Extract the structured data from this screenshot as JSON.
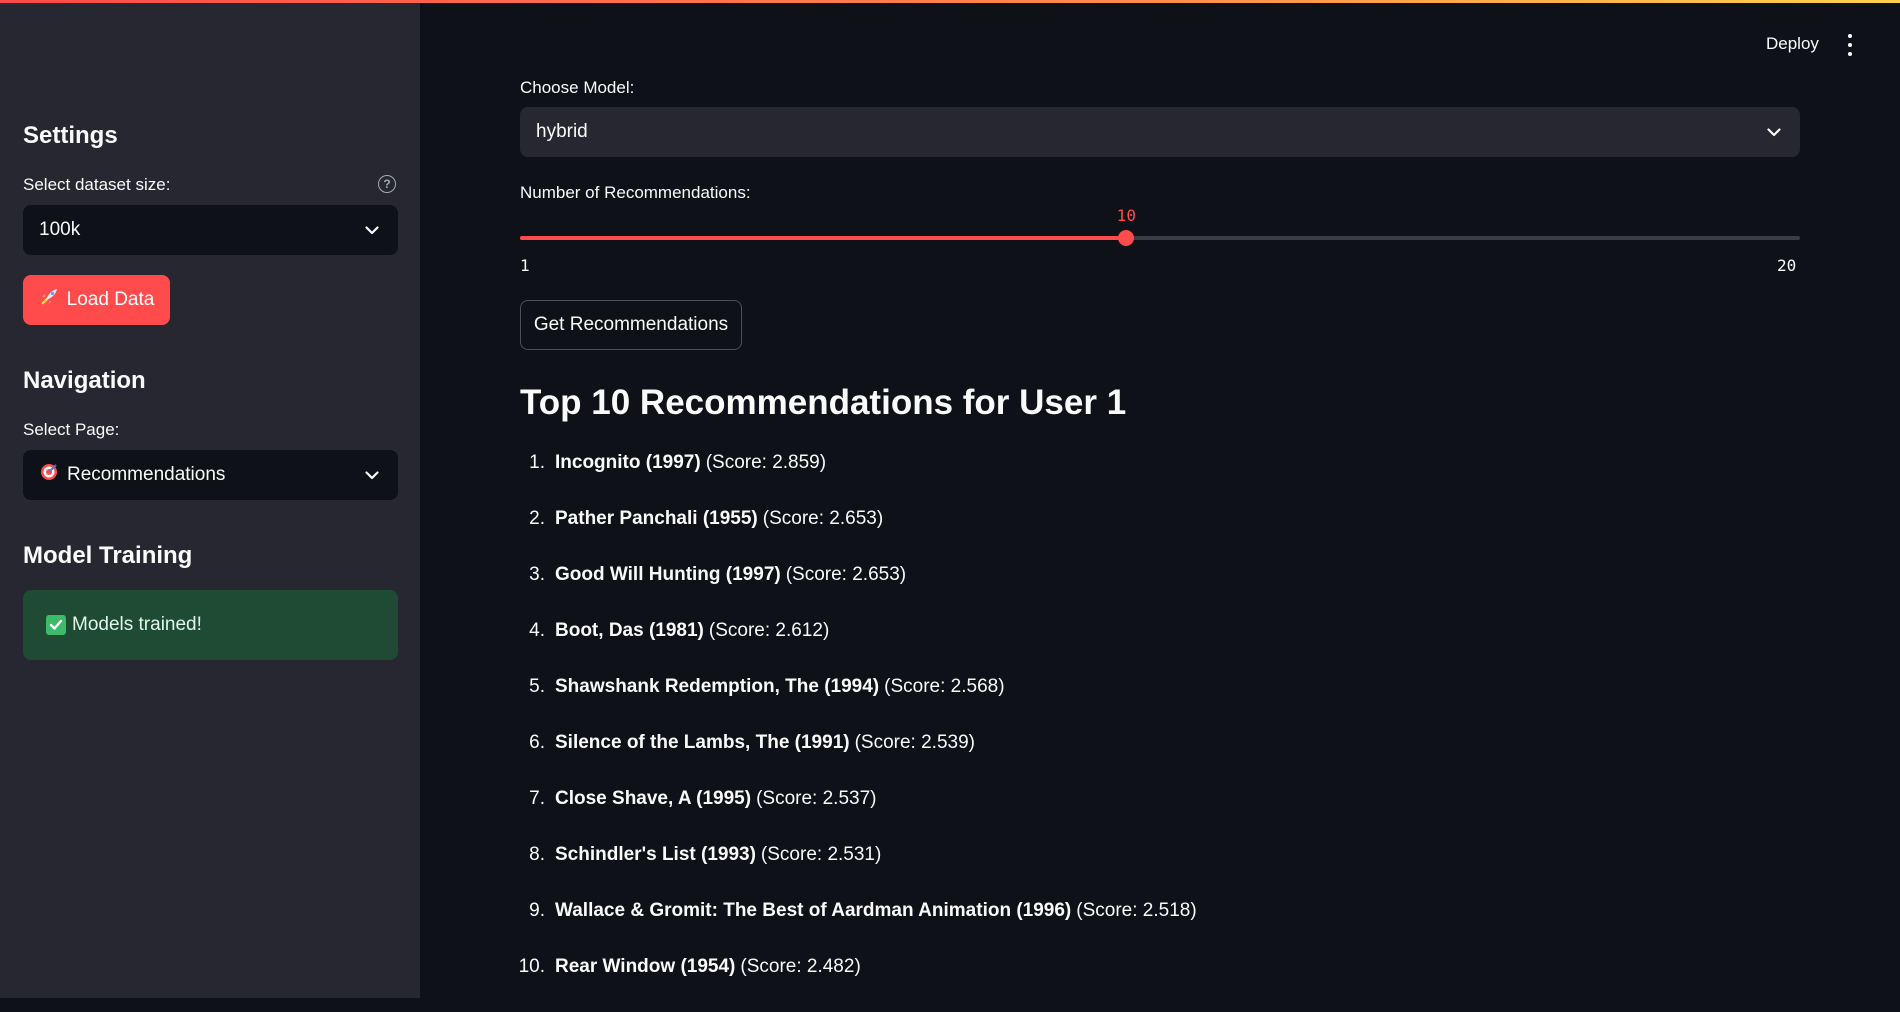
{
  "sidebar": {
    "settings_heading": "Settings",
    "dataset_label": "Select dataset size:",
    "help_icon": "question-circle-icon",
    "dataset_value": "100k",
    "load_button": "Load Data",
    "load_icon": "rocket-icon",
    "navigation_heading": "Navigation",
    "page_label": "Select Page:",
    "page_value": "Recommendations",
    "page_icon": "dart-target-icon",
    "training_heading": "Model Training",
    "success_message": "Models trained!",
    "success_icon": "check-box-icon"
  },
  "header": {
    "deploy_label": "Deploy",
    "menu_icon": "kebab-menu-icon"
  },
  "main": {
    "model_label": "Choose Model:",
    "model_value": "hybrid",
    "recs_label": "Number of Recommendations:",
    "slider": {
      "value": 10,
      "value_text": "10",
      "min": 1,
      "min_text": "1",
      "max": 20,
      "max_text": "20"
    },
    "get_button": "Get Recommendations",
    "results_title": "Top 10 Recommendations for User 1",
    "results": [
      {
        "num": "1.",
        "title": "Incognito (1997)",
        "score": "(Score: 2.859)"
      },
      {
        "num": "2.",
        "title": "Pather Panchali (1955)",
        "score": "(Score: 2.653)"
      },
      {
        "num": "3.",
        "title": "Good Will Hunting (1997)",
        "score": "(Score: 2.653)"
      },
      {
        "num": "4.",
        "title": "Boot, Das (1981)",
        "score": "(Score: 2.612)"
      },
      {
        "num": "5.",
        "title": "Shawshank Redemption, The (1994)",
        "score": "(Score: 2.568)"
      },
      {
        "num": "6.",
        "title": "Silence of the Lambs, The (1991)",
        "score": "(Score: 2.539)"
      },
      {
        "num": "7.",
        "title": "Close Shave, A (1995)",
        "score": "(Score: 2.537)"
      },
      {
        "num": "8.",
        "title": "Schindler's List (1993)",
        "score": "(Score: 2.531)"
      },
      {
        "num": "9.",
        "title": "Wallace & Gromit: The Best of Aardman Animation (1996)",
        "score": "(Score: 2.518)"
      },
      {
        "num": "10.",
        "title": "Rear Window (1954)",
        "score": "(Score: 2.482)"
      }
    ]
  },
  "colors": {
    "accent": "#ff4b4b",
    "sidebar_bg": "#262730",
    "main_bg": "#0e1117",
    "success_bg": "#1f4a34"
  }
}
